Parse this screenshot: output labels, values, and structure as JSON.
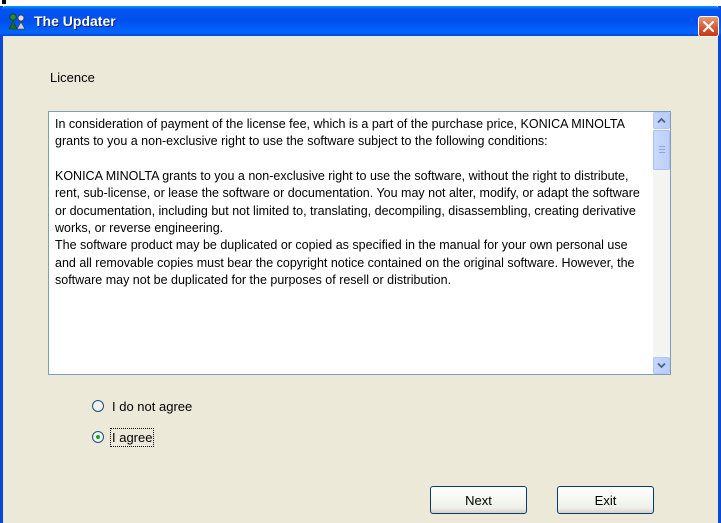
{
  "window": {
    "title": "The Updater"
  },
  "license": {
    "section_label": "Licence",
    "paragraphs": [
      "In consideration of payment of the license fee, which is a part of the purchase price, KONICA MINOLTA grants to you a non-exclusive right to use the software subject to the following conditions:",
      "KONICA MINOLTA grants to you a non-exclusive right to use the software, without the right to distribute, rent, sub-license, or lease the software or documentation. You may not alter, modify, or adapt the software or documentation, including but not limited to, translating, decompiling, disassembling, creating derivative works, or reverse engineering.",
      "The software product may be duplicated or copied as specified in the manual for your own personal use and all removable copies must bear the copyright notice contained on the original software. However, the software may not be duplicated for the purposes of resell or distribution."
    ]
  },
  "options": {
    "disagree_label": "I do not agree",
    "agree_label": "I agree",
    "selected": "agree"
  },
  "buttons": {
    "next_label": "Next",
    "exit_label": "Exit"
  },
  "colors": {
    "titlebar": "#0054e3",
    "dialog_bg": "#ece9d8",
    "close_button": "#d9532c"
  }
}
